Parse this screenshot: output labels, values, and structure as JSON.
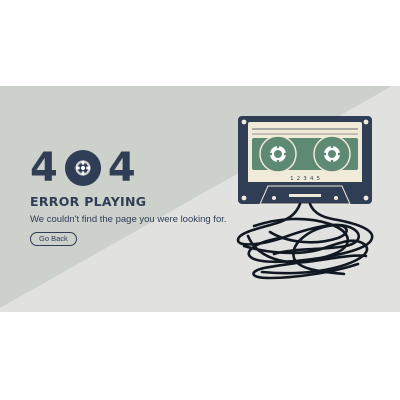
{
  "hero": {
    "digit_left": "4",
    "digit_right": "4",
    "title": "ERROR PLAYING",
    "message": "We couldn't find the page you were looking for.",
    "button_label": "Go Back"
  },
  "cassette": {
    "label_code": "1 2 3 4 5"
  },
  "colors": {
    "navy": "#2f3d55",
    "sage": "#5e8a74",
    "cream": "#f0ead8",
    "bg_light": "#e1e1df",
    "bg_sage": "#ccd1cc"
  },
  "icons": {
    "reel": "cassette-reel-icon",
    "cassette": "cassette-tape-icon",
    "tape": "tangled-tape-icon"
  }
}
